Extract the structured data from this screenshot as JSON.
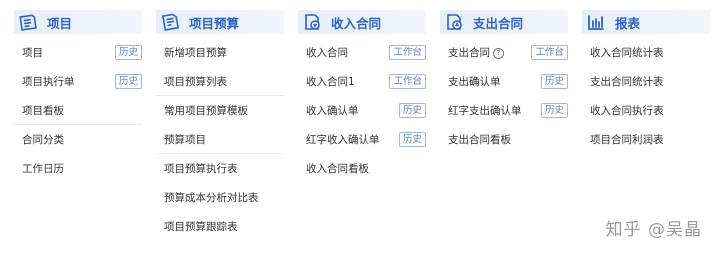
{
  "columns": [
    {
      "id": "project",
      "title": "项目",
      "icon": "document-list-icon",
      "items": [
        {
          "label": "项目",
          "badge": "历史",
          "sep": false
        },
        {
          "label": "项目执行单",
          "badge": "历史",
          "sep": false
        },
        {
          "label": "项目看板",
          "badge": "",
          "sep": true
        },
        {
          "label": "合同分类",
          "badge": "",
          "sep": false
        },
        {
          "label": "工作日历",
          "badge": "",
          "sep": false
        }
      ]
    },
    {
      "id": "budget",
      "title": "项目预算",
      "icon": "budget-document-icon",
      "items": [
        {
          "label": "新增项目预算",
          "badge": "",
          "sep": false
        },
        {
          "label": "项目预算列表",
          "badge": "",
          "sep": true
        },
        {
          "label": "常用项目预算模板",
          "badge": "",
          "sep": false
        },
        {
          "label": "预算项目",
          "badge": "",
          "sep": true
        },
        {
          "label": "项目预算执行表",
          "badge": "",
          "sep": false
        },
        {
          "label": "预算成本分析对比表",
          "badge": "",
          "sep": false
        },
        {
          "label": "项目预算跟踪表",
          "badge": "",
          "sep": false
        }
      ]
    },
    {
      "id": "income",
      "title": "收入合同",
      "icon": "income-contract-icon",
      "items": [
        {
          "label": "收入合同",
          "badge": "工作台",
          "sep": false
        },
        {
          "label": "收入合同1",
          "badge": "工作台",
          "sep": false
        },
        {
          "label": "收入确认单",
          "badge": "历史",
          "sep": false
        },
        {
          "label": "红字收入确认单",
          "badge": "历史",
          "sep": false
        },
        {
          "label": "收入合同看板",
          "badge": "",
          "sep": false
        }
      ]
    },
    {
      "id": "expense",
      "title": "支出合同",
      "icon": "expense-contract-icon",
      "items": [
        {
          "label": "支出合同",
          "badge": "工作台",
          "help": "?",
          "sep": false
        },
        {
          "label": "支出确认单",
          "badge": "历史",
          "sep": false
        },
        {
          "label": "红字支出确认单",
          "badge": "历史",
          "sep": false
        },
        {
          "label": "支出合同看板",
          "badge": "",
          "sep": false
        }
      ]
    },
    {
      "id": "report",
      "title": "报表",
      "icon": "report-chart-icon",
      "items": [
        {
          "label": "收入合同统计表",
          "badge": "",
          "sep": false
        },
        {
          "label": "支出合同统计表",
          "badge": "",
          "sep": false
        },
        {
          "label": "收入合同执行表",
          "badge": "",
          "sep": false
        },
        {
          "label": "项目合同利润表",
          "badge": "",
          "sep": false
        }
      ]
    }
  ],
  "watermark": "知乎 @吴晶",
  "colors": {
    "accent": "#2d62c2",
    "badge_border": "#9fb6e0",
    "header_bg": "#e6eefa"
  }
}
